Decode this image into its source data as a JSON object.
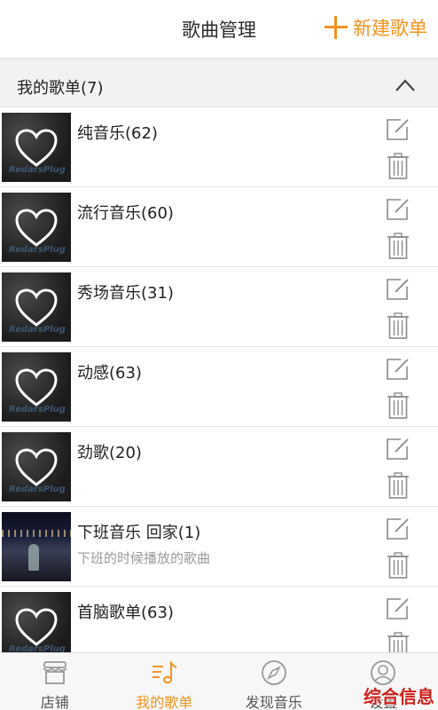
{
  "header": {
    "title": "歌曲管理",
    "new_playlist_label": "新建歌单"
  },
  "section": {
    "label": "我的歌单(7)"
  },
  "playlists": [
    {
      "name": "纯音乐(62)",
      "description": "",
      "cover": "default-heart-cover"
    },
    {
      "name": "流行音乐(60)",
      "description": "",
      "cover": "default-heart-cover"
    },
    {
      "name": "秀场音乐(31)",
      "description": "",
      "cover": "default-heart-cover"
    },
    {
      "name": "动感(63)",
      "description": "",
      "cover": "default-heart-cover"
    },
    {
      "name": "劲歌(20)",
      "description": "",
      "cover": "default-heart-cover"
    },
    {
      "name": "下班音乐 回家(1)",
      "description": "下班的时候播放的歌曲",
      "cover": "night-street-photo"
    },
    {
      "name": "首脑歌单(63)",
      "description": "",
      "cover": "default-heart-cover"
    }
  ],
  "tabs": [
    {
      "label": "店铺",
      "icon": "store-icon",
      "active": false
    },
    {
      "label": "我的歌单",
      "icon": "music-playlist-icon",
      "active": true
    },
    {
      "label": "发现音乐",
      "icon": "compass-icon",
      "active": false
    },
    {
      "label": "设置",
      "icon": "user-icon",
      "active": false
    }
  ],
  "watermark": "综合信息",
  "cover_watermark": "RedarsPlug",
  "colors": {
    "accent": "#f39321",
    "watermark": "#d0201c"
  }
}
